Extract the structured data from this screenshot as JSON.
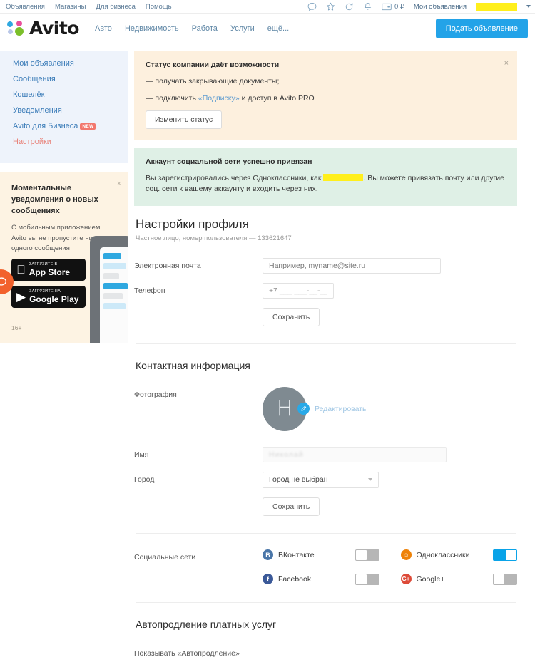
{
  "topbar": {
    "links": [
      {
        "label": "Объявления"
      },
      {
        "label": "Магазины"
      },
      {
        "label": "Для бизнеса"
      },
      {
        "label": "Помощь"
      }
    ],
    "icons": [
      {
        "name": "message-icon"
      },
      {
        "name": "star-icon"
      },
      {
        "name": "history-icon"
      },
      {
        "name": "bell-icon"
      }
    ],
    "wallet": {
      "icon": "wallet-icon",
      "amount": "0 ₽"
    },
    "my_ads_label": "Мои объявления",
    "username_redacted": "",
    "caret": "chevron-down-icon"
  },
  "header": {
    "logo_text": "Avito",
    "nav": [
      {
        "label": "Авто"
      },
      {
        "label": "Недвижимость"
      },
      {
        "label": "Работа"
      },
      {
        "label": "Услуги"
      },
      {
        "label": "ещё..."
      }
    ],
    "post_button": "Подать объявление"
  },
  "sidebar": {
    "items": [
      {
        "label": "Мои объявления",
        "active": false,
        "badge": ""
      },
      {
        "label": "Сообщения",
        "active": false,
        "badge": ""
      },
      {
        "label": "Кошелёк",
        "active": false,
        "badge": ""
      },
      {
        "label": "Уведомления",
        "active": false,
        "badge": ""
      },
      {
        "label": "Avito для Бизнеса",
        "active": false,
        "badge": "NEW"
      },
      {
        "label": "Настройки",
        "active": true,
        "badge": ""
      }
    ],
    "promo": {
      "title": "Моментальные уведомления о новых сообщениях",
      "text": "С мобильным приложением Avito вы не пропустите ни одного сообщения",
      "appstore_top": "Загрузите в",
      "appstore_main": "App Store",
      "googleplay_top": "Загрузите на",
      "googleplay_main": "Google Play",
      "age_rating": "16+",
      "close": "×"
    }
  },
  "banners": {
    "company_status": {
      "title": "Статус компании даёт возможности",
      "line1": "— получать закрывающие документы;",
      "line2_pre": "— подключить ",
      "line2_link": "«Подписку»",
      "line2_post": " и доступ в Avito PRO",
      "button": "Изменить статус",
      "close": "×"
    },
    "social_linked": {
      "title": "Аккаунт социальной сети успешно привязан",
      "text_pre": "Вы зарегистрировались через Одноклассники, как",
      "text_post": ". Вы можете привязать почту или другие соц. сети к вашему аккаунту и входить через них."
    }
  },
  "profile": {
    "title": "Настройки профиля",
    "subtitle": "Частное лицо, номер пользователя — 133621647",
    "email_label": "Электронная почта",
    "email_placeholder": "Например, myname@site.ru",
    "email_value": "",
    "phone_label": "Телефон",
    "phone_value": "+7 ___ ___-__-__",
    "save_label": "Сохранить"
  },
  "contacts": {
    "title": "Контактная информация",
    "photo_label": "Фотография",
    "avatar_letter": "Н",
    "edit_link": "Редактировать",
    "name_label": "Имя",
    "name_value": "Николай",
    "city_label": "Город",
    "city_value": "Город не выбран",
    "save_label": "Сохранить"
  },
  "social": {
    "label": "Социальные сети",
    "networks": [
      {
        "name": "ВКонтакте",
        "icon": "vk-icon",
        "glyph": "B",
        "enabled": false
      },
      {
        "name": "Одноклассники",
        "icon": "ok-icon",
        "glyph": "☺",
        "enabled": true
      },
      {
        "name": "Facebook",
        "icon": "facebook-icon",
        "glyph": "f",
        "enabled": false
      },
      {
        "name": "Google+",
        "icon": "googleplus-icon",
        "glyph": "G+",
        "enabled": false
      }
    ]
  },
  "autorenew": {
    "title": "Автопродление платных услуг",
    "row_label": "Показывать «Автопродление»",
    "enabled": false
  },
  "colors": {
    "brand_blue": "#23a3e8",
    "link_blue": "#5f87a6",
    "active_red": "#e8837a",
    "banner_orange": "#fdf0de",
    "banner_green": "#dff0e6",
    "redact_yellow": "#ffef1c"
  }
}
